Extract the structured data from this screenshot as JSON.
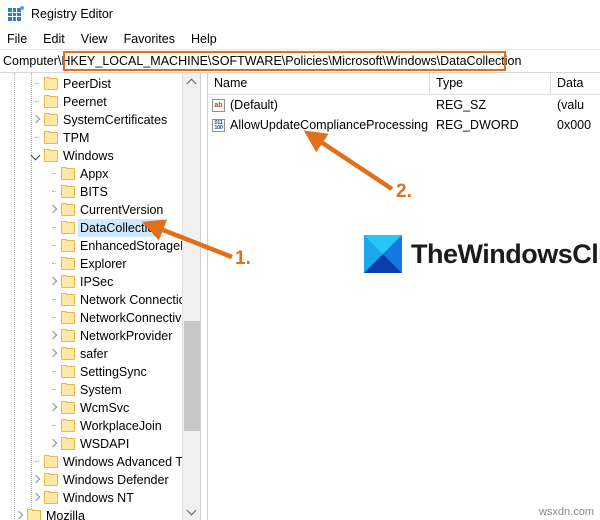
{
  "window": {
    "title": "Registry Editor",
    "icon": "registry-editor-icon"
  },
  "menubar": {
    "items": [
      {
        "label": "File"
      },
      {
        "label": "Edit"
      },
      {
        "label": "View"
      },
      {
        "label": "Favorites"
      },
      {
        "label": "Help"
      }
    ]
  },
  "address_bar": {
    "prefix": "Computer\\",
    "path": "HKEY_LOCAL_MACHINE\\SOFTWARE\\Policies\\Microsoft\\Windows\\DataCollection",
    "highlight_color": "#E0701A"
  },
  "tree": {
    "items": [
      {
        "label": "PeerDist",
        "depth": 2,
        "state": "leaf",
        "selected": false
      },
      {
        "label": "Peernet",
        "depth": 2,
        "state": "leaf",
        "selected": false
      },
      {
        "label": "SystemCertificates",
        "depth": 2,
        "state": "collapsed",
        "selected": false
      },
      {
        "label": "TPM",
        "depth": 2,
        "state": "leaf",
        "selected": false
      },
      {
        "label": "Windows",
        "depth": 2,
        "state": "expanded",
        "selected": false
      },
      {
        "label": "Appx",
        "depth": 3,
        "state": "leaf",
        "selected": false
      },
      {
        "label": "BITS",
        "depth": 3,
        "state": "leaf",
        "selected": false
      },
      {
        "label": "CurrentVersion",
        "depth": 3,
        "state": "collapsed",
        "selected": false
      },
      {
        "label": "DataCollection",
        "depth": 3,
        "state": "leaf",
        "selected": true
      },
      {
        "label": "EnhancedStorageDevices",
        "depth": 3,
        "state": "leaf",
        "selected": false
      },
      {
        "label": "Explorer",
        "depth": 3,
        "state": "leaf",
        "selected": false
      },
      {
        "label": "IPSec",
        "depth": 3,
        "state": "collapsed",
        "selected": false
      },
      {
        "label": "Network Connections",
        "depth": 3,
        "state": "leaf",
        "selected": false
      },
      {
        "label": "NetworkConnectivityStatusIndicator",
        "depth": 3,
        "state": "leaf",
        "selected": false
      },
      {
        "label": "NetworkProvider",
        "depth": 3,
        "state": "collapsed",
        "selected": false
      },
      {
        "label": "safer",
        "depth": 3,
        "state": "collapsed",
        "selected": false
      },
      {
        "label": "SettingSync",
        "depth": 3,
        "state": "leaf",
        "selected": false
      },
      {
        "label": "System",
        "depth": 3,
        "state": "leaf",
        "selected": false
      },
      {
        "label": "WcmSvc",
        "depth": 3,
        "state": "collapsed",
        "selected": false
      },
      {
        "label": "WorkplaceJoin",
        "depth": 3,
        "state": "leaf",
        "selected": false
      },
      {
        "label": "WSDAPI",
        "depth": 3,
        "state": "collapsed",
        "selected": false
      },
      {
        "label": "Windows Advanced Threat Protection",
        "depth": 2,
        "state": "leaf",
        "selected": false
      },
      {
        "label": "Windows Defender",
        "depth": 2,
        "state": "collapsed",
        "selected": false
      },
      {
        "label": "Windows NT",
        "depth": 2,
        "state": "collapsed",
        "selected": false
      },
      {
        "label": "Mozilla",
        "depth": 1,
        "state": "collapsed",
        "selected": false
      }
    ],
    "scrollbar": {
      "up_arrow": "chevron-up-icon",
      "down_arrow": "chevron-down-icon"
    }
  },
  "list": {
    "columns": [
      {
        "label": "Name"
      },
      {
        "label": "Type"
      },
      {
        "label": "Data"
      }
    ],
    "rows": [
      {
        "icon": "reg-sz-icon",
        "icon_text": "ab",
        "name": "(Default)",
        "type": "REG_SZ",
        "data": "(valu"
      },
      {
        "icon": "reg-dword-icon",
        "icon_text": "011100",
        "name": "AllowUpdateComplianceProcessing",
        "type": "REG_DWORD",
        "data": "0x000"
      }
    ]
  },
  "logo": {
    "text": "TheWindowsClub",
    "color_light": "#27C4F5",
    "color_mid": "#1479E0",
    "color_dark": "#0B3FAE"
  },
  "annotations": [
    {
      "label": "1.",
      "target": "tree-item-datacollection"
    },
    {
      "label": "2.",
      "target": "list-row-allowupdatecomplianceprocessing"
    }
  ],
  "watermark": {
    "text": "wsxdn.com"
  }
}
